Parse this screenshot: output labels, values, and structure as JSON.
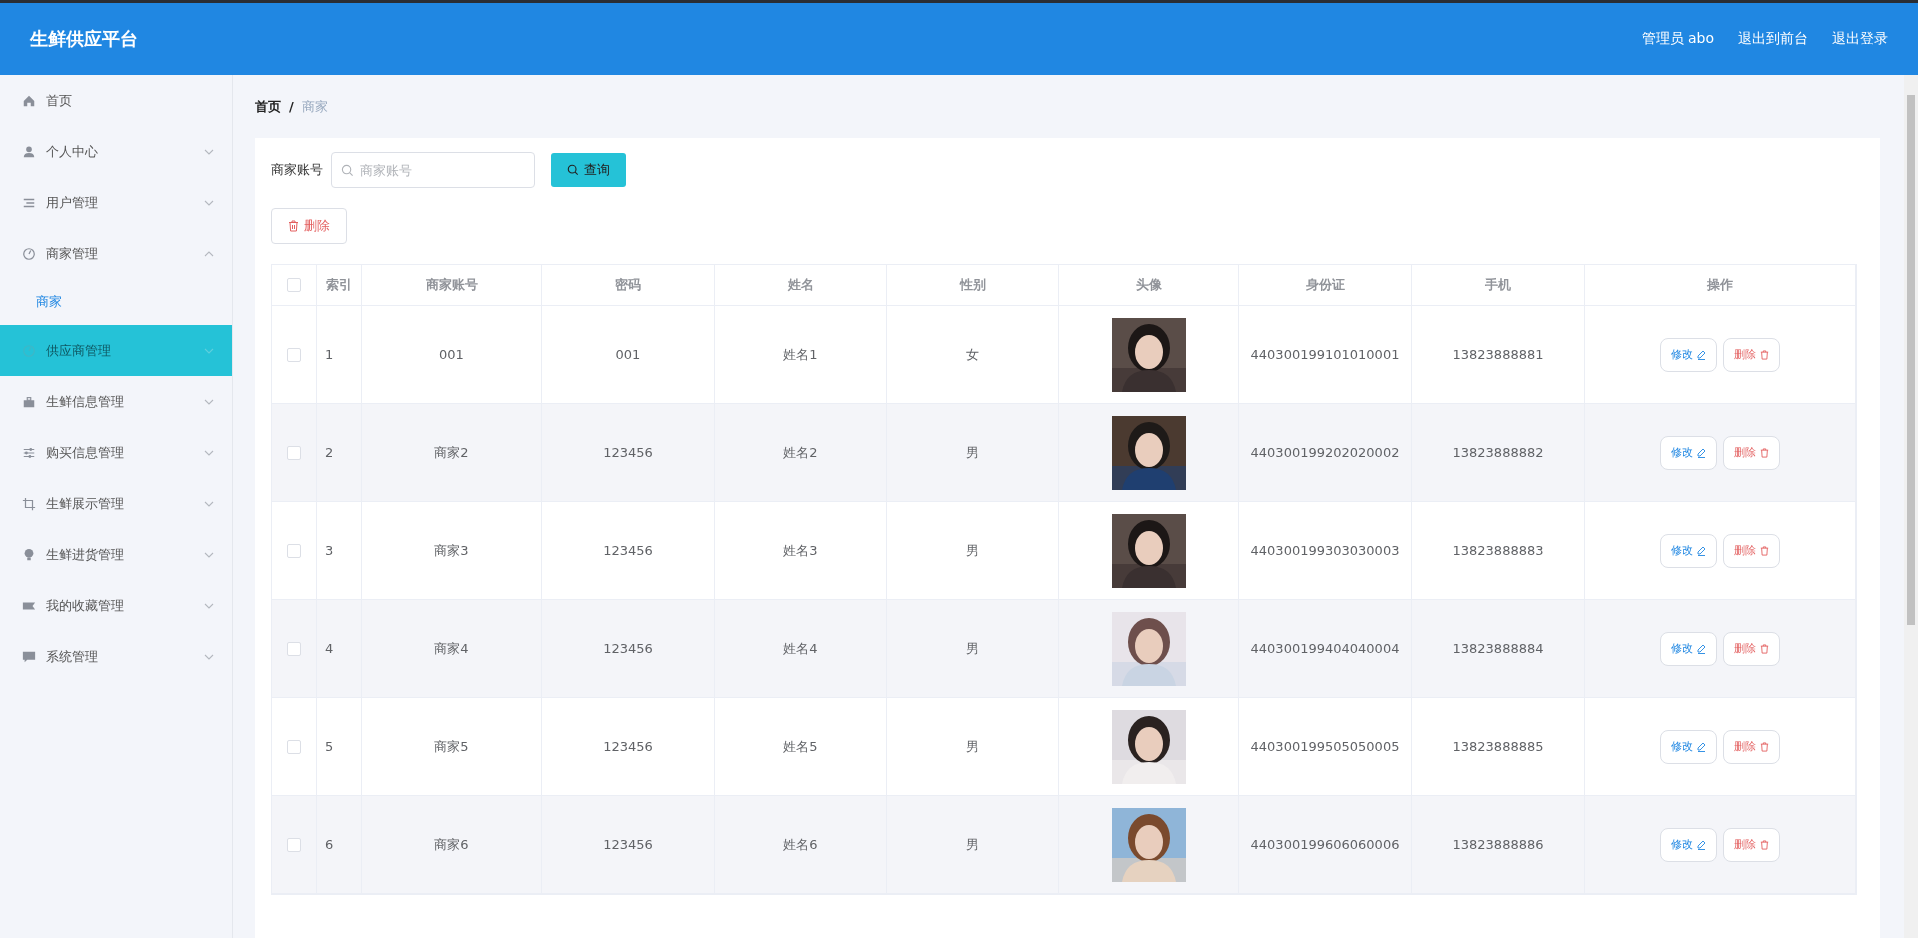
{
  "header": {
    "title": "生鲜供应平台",
    "user": "管理员 abo",
    "links": [
      "退出到前台",
      "退出登录"
    ]
  },
  "sidebar": {
    "items": [
      {
        "label": "首页",
        "kind": "link",
        "hovered": false
      },
      {
        "label": "个人中心",
        "kind": "menu",
        "expanded": false,
        "hovered": false
      },
      {
        "label": "用户管理",
        "kind": "menu",
        "expanded": false,
        "hovered": false
      },
      {
        "label": "商家管理",
        "kind": "menu",
        "expanded": true,
        "hovered": false,
        "children": [
          {
            "label": "商家",
            "selected": true
          }
        ]
      },
      {
        "label": "供应商管理",
        "kind": "menu",
        "expanded": false,
        "hovered": true
      },
      {
        "label": "生鲜信息管理",
        "kind": "menu",
        "expanded": false,
        "hovered": false
      },
      {
        "label": "购买信息管理",
        "kind": "menu",
        "expanded": false,
        "hovered": false
      },
      {
        "label": "生鲜展示管理",
        "kind": "menu",
        "expanded": false,
        "hovered": false
      },
      {
        "label": "生鲜进货管理",
        "kind": "menu",
        "expanded": false,
        "hovered": false
      },
      {
        "label": "我的收藏管理",
        "kind": "menu",
        "expanded": false,
        "hovered": false
      },
      {
        "label": "系统管理",
        "kind": "menu",
        "expanded": false,
        "hovered": false
      }
    ]
  },
  "breadcrumb": [
    "首页",
    "/",
    "商家"
  ],
  "search": {
    "label": "商家账号",
    "placeholder": "商家账号",
    "button": "查询"
  },
  "delete_button": "删除",
  "table": {
    "header_checked": false,
    "columns": [
      "索引",
      "商家账号",
      "密码",
      "姓名",
      "性别",
      "头像",
      "身份证",
      "手机",
      "操作"
    ],
    "rows": [
      {
        "checked": false,
        "cells": [
          "1",
          "001",
          "001",
          "姓名1",
          "女"
        ],
        "avatar": {
          "kind": "picture"
        },
        "id_card": "440300199101010001",
        "phone": "13823888881",
        "actions": [
          "修改",
          "删除"
        ]
      },
      {
        "checked": false,
        "cells": [
          "2",
          "商家2",
          "123456",
          "姓名2",
          "男"
        ],
        "avatar": {
          "kind": "picture"
        },
        "id_card": "440300199202020002",
        "phone": "13823888882",
        "actions": [
          "修改",
          "删除"
        ]
      },
      {
        "checked": false,
        "cells": [
          "3",
          "商家3",
          "123456",
          "姓名3",
          "男"
        ],
        "avatar": {
          "kind": "picture"
        },
        "id_card": "440300199303030003",
        "phone": "13823888883",
        "actions": [
          "修改",
          "删除"
        ]
      },
      {
        "checked": false,
        "cells": [
          "4",
          "商家4",
          "123456",
          "姓名4",
          "男"
        ],
        "avatar": {
          "kind": "picture"
        },
        "id_card": "440300199404040004",
        "phone": "13823888884",
        "actions": [
          "修改",
          "删除"
        ]
      },
      {
        "checked": false,
        "cells": [
          "5",
          "商家5",
          "123456",
          "姓名5",
          "男"
        ],
        "avatar": {
          "kind": "picture"
        },
        "id_card": "440300199505050005",
        "phone": "13823888885",
        "actions": [
          "修改",
          "删除"
        ]
      },
      {
        "checked": false,
        "cells": [
          "6",
          "商家6",
          "123456",
          "姓名6",
          "男"
        ],
        "avatar": {
          "kind": "picture"
        },
        "id_card": "440300199606060006",
        "phone": "13823888886",
        "actions": [
          "修改",
          "删除"
        ]
      }
    ]
  }
}
